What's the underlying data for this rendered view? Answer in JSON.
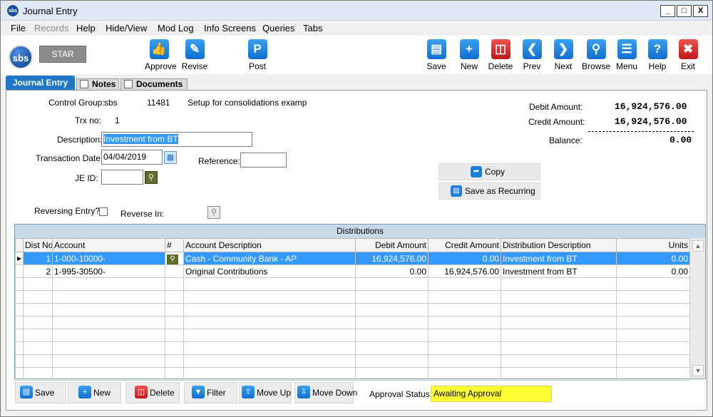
{
  "window": {
    "app_icon": "sbs",
    "title": "Journal Entry",
    "controls": {
      "minimize": "_",
      "maximize": "□",
      "close": "X"
    }
  },
  "menu": {
    "file": "File",
    "records": "Records",
    "help": "Help",
    "hide_view": "Hide/View",
    "mod_log": "Mod Log",
    "info_screens": "Info Screens",
    "queries": "Queries",
    "tabs": "Tabs"
  },
  "toolbar": {
    "logo": "sbs",
    "company": "STAR",
    "approve": "Approve",
    "revise": "Revise",
    "post": "Post",
    "save": "Save",
    "new": "New",
    "delete": "Delete",
    "prev": "Prev",
    "next": "Next",
    "browse": "Browse",
    "menu": "Menu",
    "help": "Help",
    "exit": "Exit",
    "icons": {
      "approve": "thumbs-up-icon",
      "revise": "edit-icon",
      "post": "post-icon",
      "save": "floppy-icon",
      "new": "new-doc-icon",
      "delete": "trash-icon",
      "prev": "chevron-left-icon",
      "next": "chevron-right-icon",
      "browse": "browse-search-icon",
      "menu": "menu-list-icon",
      "help": "question-icon",
      "exit": "close-icon"
    },
    "colors": {
      "primary": "#1f7fd8",
      "danger": "#d32020"
    }
  },
  "tabs": {
    "journal_entry": "Journal Entry",
    "notes": "Notes",
    "documents": "Documents"
  },
  "form": {
    "control_group_label": "Control Group:",
    "control_group_code": "sbs",
    "control_group_number": "11481",
    "control_group_desc": "Setup for consolidations examp",
    "trx_no_label": "Trx no:",
    "trx_no": "1",
    "description_label": "Description:",
    "description": "Investment from BT",
    "transaction_date_label": "Transaction Date:",
    "transaction_date": "04/04/2019",
    "reference_label": "Reference:",
    "reference": "",
    "je_id_label": "JE ID:",
    "je_id": "",
    "reversing_entry_label": "Reversing Entry?",
    "reversing_entry": false,
    "reverse_in_label": "Reverse In:"
  },
  "totals": {
    "debit_label": "Debit Amount:",
    "debit": "16,924,576.00",
    "credit_label": "Credit Amount:",
    "credit": "16,924,576.00",
    "balance_label": "Balance:",
    "balance": "0.00"
  },
  "actions": {
    "copy": "Copy",
    "save_as_recurring": "Save as Recurring"
  },
  "distributions": {
    "caption": "Distributions",
    "columns": [
      "Dist No",
      "Account",
      "#",
      "Account Description",
      "Debit Amount",
      "Credit Amount",
      "Distribution Description",
      "Units"
    ],
    "rows": [
      {
        "dist_no": "1",
        "account": "1-000-10000-",
        "account_description": "Cash - Community Bank - AP",
        "debit": "16,924,576.00",
        "credit": "0.00",
        "distribution_description": "Investment from BT",
        "units": "0.00"
      },
      {
        "dist_no": "2",
        "account": "1-995-30500-",
        "account_description": "Original Contributions",
        "debit": "0.00",
        "credit": "16,924,576.00",
        "distribution_description": "Investment from BT",
        "units": "0.00"
      }
    ],
    "selected_color": "#3399ff"
  },
  "bottom": {
    "save": "Save",
    "new": "New",
    "delete": "Delete",
    "filter": "Filter",
    "move_up": "Move Up",
    "move_down": "Move Down",
    "approval_status_label": "Approval Status:",
    "approval_status": "Awaiting Approval",
    "status_color": "#ffff33"
  }
}
